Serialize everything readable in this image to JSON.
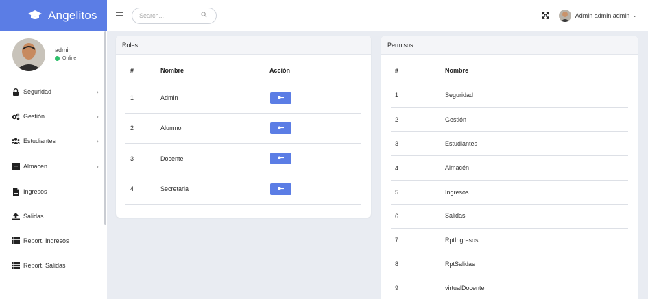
{
  "brand": {
    "name": "Angelitos",
    "icon": "graduation-cap-icon"
  },
  "header": {
    "search_placeholder": "Search...",
    "user_name": "Admin admin admin",
    "caret": "⌄"
  },
  "sidebar": {
    "user": {
      "name": "admin",
      "status": "Online",
      "status_color": "#2ec06b"
    },
    "items": [
      {
        "label": "Seguridad",
        "icon": "lock-icon",
        "arrow": "›"
      },
      {
        "label": "Gestión",
        "icon": "cogs-icon",
        "arrow": "›"
      },
      {
        "label": "Estudiantes",
        "icon": "users-icon",
        "arrow": "›"
      },
      {
        "label": "Almacen",
        "icon": "warehouse-icon",
        "arrow": "›"
      },
      {
        "label": "Ingresos",
        "icon": "file-icon"
      },
      {
        "label": "Salidas",
        "icon": "upload-icon"
      },
      {
        "label": "Report. Ingresos",
        "icon": "list-icon"
      },
      {
        "label": "Report. Salidas",
        "icon": "list-icon"
      }
    ]
  },
  "roles": {
    "title": "Roles",
    "headers": {
      "num": "#",
      "name": "Nombre",
      "action": "Acción"
    },
    "rows": [
      {
        "num": "1",
        "name": "Admin"
      },
      {
        "num": "2",
        "name": "Alumno"
      },
      {
        "num": "3",
        "name": "Docente"
      },
      {
        "num": "4",
        "name": "Secretaria"
      }
    ],
    "action_icon": "key-icon"
  },
  "permisos": {
    "title": "Permisos",
    "headers": {
      "num": "#",
      "name": "Nombre"
    },
    "rows": [
      {
        "num": "1",
        "name": "Seguridad"
      },
      {
        "num": "2",
        "name": "Gestión"
      },
      {
        "num": "3",
        "name": "Estudiantes"
      },
      {
        "num": "4",
        "name": "Almacén"
      },
      {
        "num": "5",
        "name": "Ingresos"
      },
      {
        "num": "6",
        "name": "Salidas"
      },
      {
        "num": "7",
        "name": "RptIngresos"
      },
      {
        "num": "8",
        "name": "RptSalidas"
      },
      {
        "num": "9",
        "name": "virtualDocente"
      }
    ]
  },
  "colors": {
    "accent": "#5b7de5",
    "background": "#e9ecf2",
    "online": "#2ec06b"
  }
}
